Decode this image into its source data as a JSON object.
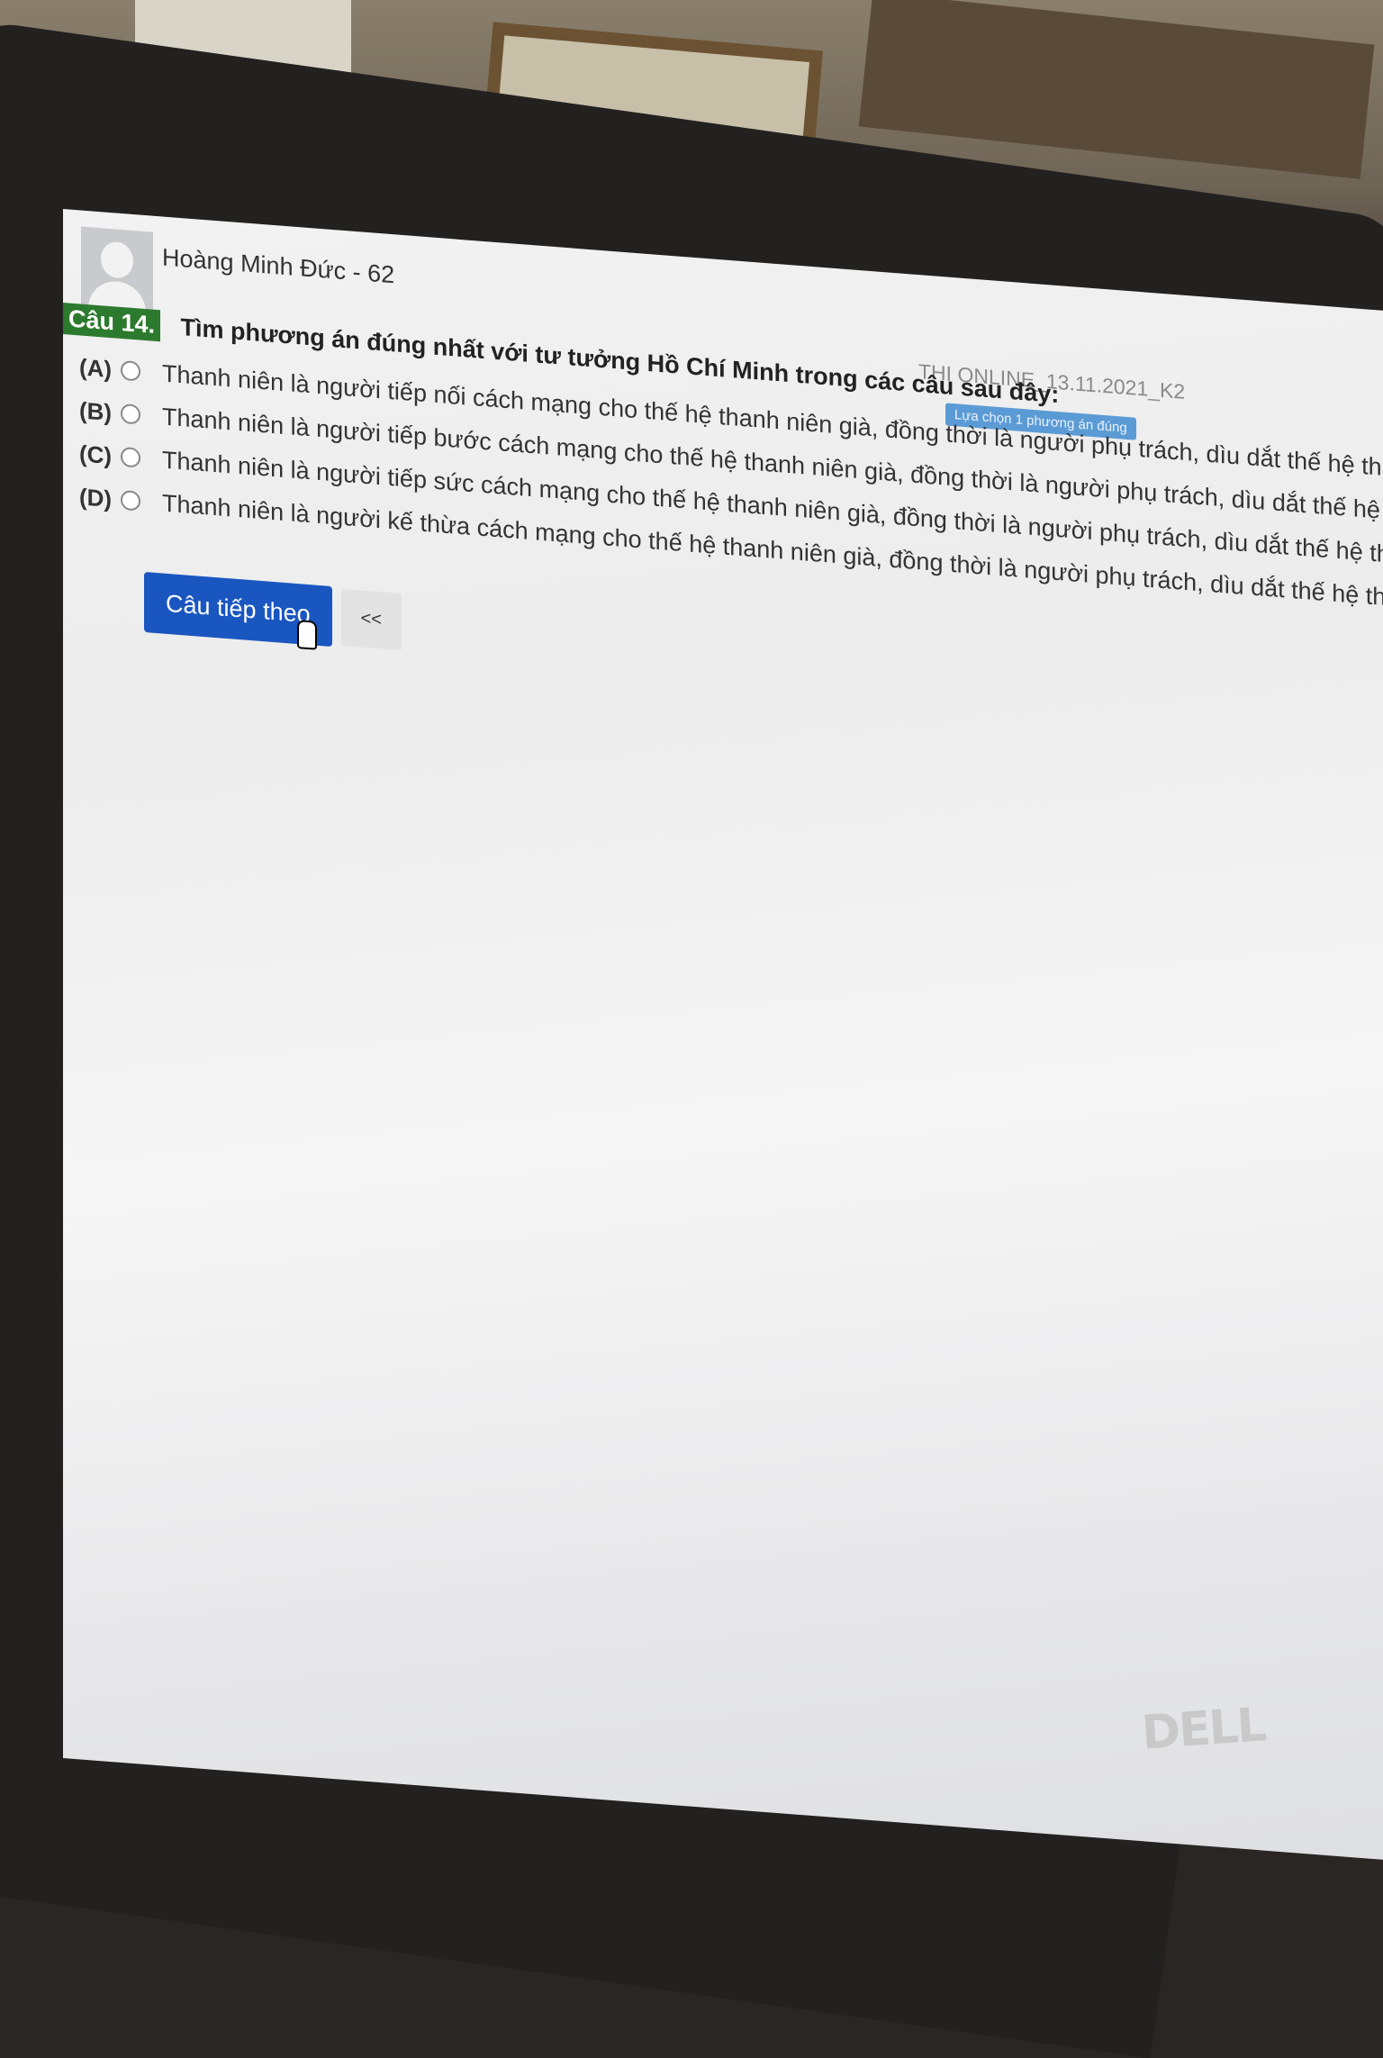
{
  "user": {
    "name": "Hoàng Minh Đức - 62"
  },
  "exam": {
    "title": "THI ONLINE_13.11.2021_K2",
    "hint": "Lựa chọn 1 phương án đúng"
  },
  "question": {
    "number_label": "Câu 14.",
    "text": "Tìm phương án đúng nhất với tư tưởng Hồ Chí Minh trong các câu sau đây:"
  },
  "options": [
    {
      "letter": "(A)",
      "text": "Thanh niên là người tiếp nối cách mạng cho thế hệ thanh niên già, đồng thời là người phụ trách, dìu dắt thế hệ thanh niên tư"
    },
    {
      "letter": "(B)",
      "text": "Thanh niên là người tiếp bước cách mạng cho thế hệ thanh niên già, đồng thời là người phụ trách, dìu dắt thế hệ thanh niên"
    },
    {
      "letter": "(C)",
      "text": "Thanh niên là người tiếp sức cách mạng cho thế hệ thanh niên già, đồng thời là người phụ trách, dìu dắt thế hệ thanh niên t"
    },
    {
      "letter": "(D)",
      "text": "Thanh niên là người kế thừa cách mạng cho thế hệ thanh niên già, đồng thời là người phụ trách, dìu dắt thế hệ thanh niên tư"
    }
  ],
  "buttons": {
    "next_label": "Câu tiếp theo",
    "prev_label": "<<"
  },
  "brand": {
    "logo_text": "DELL"
  },
  "colors": {
    "question_badge": "#2c7a2e",
    "next_button": "#1a56c0",
    "hint_badge": "#5b9bd5"
  }
}
